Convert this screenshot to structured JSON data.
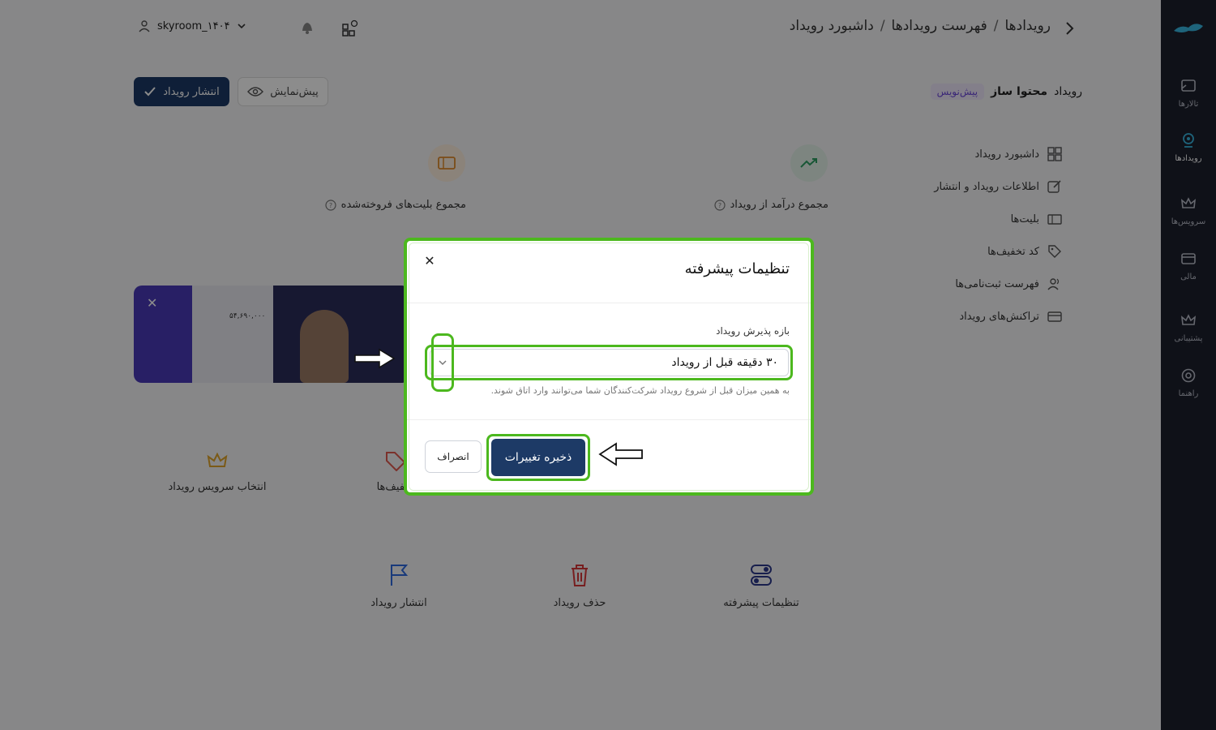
{
  "header": {
    "breadcrumb": [
      "رویدادها",
      "فهرست رویدادها",
      "داشبورد رویداد"
    ],
    "breadcrumb_sep": "/",
    "username": "skyroom_۱۴۰۴"
  },
  "subheader": {
    "title_prefix": "رویداد",
    "title_bold": "محتوا ساز",
    "status_chip": "پیش‌نویس",
    "publish_label": "انتشار رویداد",
    "preview_label": "پیش‌نمایش"
  },
  "rail": {
    "items": [
      {
        "label": "تالارها",
        "icon": "room-icon"
      },
      {
        "label": "رویدادها",
        "icon": "event-icon",
        "active": true
      },
      {
        "label": "سرویس‌ها",
        "icon": "crown-icon"
      },
      {
        "label": "مالی",
        "icon": "card-icon"
      },
      {
        "label": "پشتیبانی",
        "icon": "support-icon"
      },
      {
        "label": "راهنما",
        "icon": "help-icon"
      }
    ]
  },
  "side_menu": {
    "items": [
      {
        "label": "داشبورد رویداد",
        "icon": "dashboard-icon"
      },
      {
        "label": "اطلاعات رویداد و انتشار",
        "icon": "edit-icon"
      },
      {
        "label": "بلیت‌ها",
        "icon": "ticket-icon"
      },
      {
        "label": "کد تخفیف‌ها",
        "icon": "tag-icon"
      },
      {
        "label": "فهرست ثبت‌نامی‌ها",
        "icon": "users-icon"
      },
      {
        "label": "تراکنش‌های رویداد",
        "icon": "transactions-icon"
      }
    ]
  },
  "stats": {
    "revenue_label": "مجموع درآمد از رویداد",
    "tickets_label": "مجموع بلیت‌های فروخته‌شده"
  },
  "banner": {
    "price": "۵۴,۶۹۰,۰۰۰"
  },
  "cards": {
    "row1": [
      {
        "label": "انتخاب سرویس رویداد",
        "icon": "crown-icon"
      },
      {
        "label": "تخفیف‌ها",
        "icon": "tag-icon"
      }
    ],
    "row2": [
      {
        "label": "انتشار رویداد",
        "icon": "flag-icon"
      },
      {
        "label": "حذف رویداد",
        "icon": "trash-icon"
      },
      {
        "label": "تنظیمات پیشرفته",
        "icon": "settings-icon"
      }
    ]
  },
  "modal": {
    "title": "تنظیمات پیشرفته",
    "field_label": "بازه پذیرش رویداد",
    "selected_value": "۳۰ دقیقه قبل از رویداد",
    "hint": "به همین میزان قبل از شروع رویداد شرکت‌کنندگان شما می‌توانند وارد اتاق شوند.",
    "save_label": "ذخیره تغییرات",
    "cancel_label": "انصراف"
  },
  "colors": {
    "primary": "#1d3a66",
    "highlight": "#4cb81e",
    "rail_bg": "#1c1f2c",
    "chip_text": "#6b46d9"
  }
}
